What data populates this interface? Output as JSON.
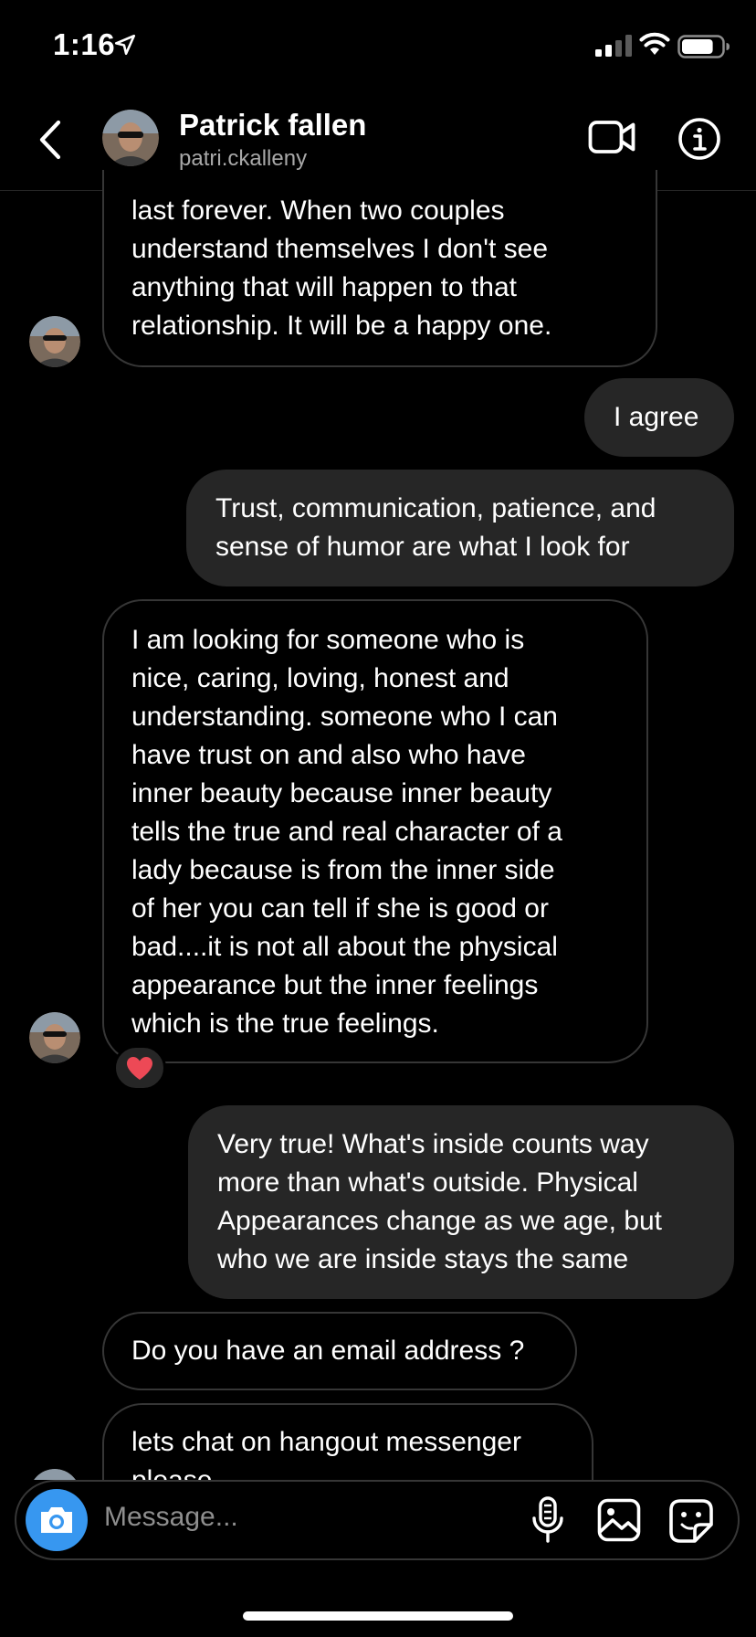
{
  "status_bar": {
    "time": "1:16",
    "battery_percent": 80
  },
  "header": {
    "name": "Patrick fallen",
    "handle": "patri.ckalleny",
    "icons": [
      "back-chevron-icon",
      "video-call-icon",
      "info-icon"
    ]
  },
  "messages": [
    {
      "direction": "incoming",
      "lines": [
        "last forever. When two couples",
        "understand themselves I don't see",
        "anything that will happen to that",
        "relationship. It will be a happy one."
      ]
    },
    {
      "direction": "outgoing",
      "lines": [
        "I agree"
      ]
    },
    {
      "direction": "outgoing",
      "lines": [
        "Trust, communication, patience, and",
        "sense of humor are what I look for"
      ]
    },
    {
      "direction": "incoming",
      "reaction": "❤️",
      "lines": [
        "I am looking for someone who is",
        "nice, caring, loving, honest and",
        "understanding. someone who I can",
        "have trust on and also who  have",
        "inner beauty  because inner beauty",
        "tells the true and real  character of a",
        "lady because is from the inner  side",
        "of her you can tell if she is good or",
        "bad....it is not all about the physical",
        "appearance but the inner feelings",
        "which is the true feelings."
      ]
    },
    {
      "direction": "outgoing",
      "lines": [
        "Very true! What's inside counts way",
        "more than what's outside. Physical",
        "Appearances change as we age, but",
        "who we are inside stays the same"
      ]
    },
    {
      "direction": "incoming",
      "lines": [
        "Do you have an email address ?"
      ]
    },
    {
      "direction": "incoming",
      "lines": [
        "lets chat on hangout messenger",
        "please"
      ]
    }
  ],
  "composer": {
    "placeholder": "Message...",
    "icons": [
      "camera-icon",
      "microphone-icon",
      "gallery-icon",
      "sticker-icon"
    ]
  },
  "colors": {
    "background": "#000000",
    "outgoing_bubble": "#262626",
    "incoming_border": "#363636",
    "camera_button": "#3797f0"
  }
}
